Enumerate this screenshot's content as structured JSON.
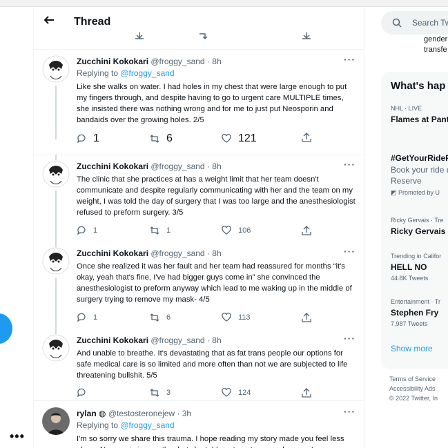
{
  "header": {
    "title": "Thread"
  },
  "left_nav": {
    "more_glyph": "•••"
  },
  "thread": {
    "tweets": [
      {
        "name": "Zucchini Kokokari",
        "handle": "@froggy_sand · 8h",
        "replying_prefix": "Replying to ",
        "replying_to": "@froggy_sand",
        "text": "Like she walks on water. I had holes in my chest that were large enough to put my fingers through, and despite having to go to urgent care MULTIPLE times, she insisted there was nothing wrong and for me to just put Neosporin and bandaids over the growing holes. 2/5",
        "replies": "1",
        "retweets": "6",
        "likes": "121"
      },
      {
        "name": "Zucchini Kokokari",
        "handle": "@froggy_sand · 8h",
        "text": "The clinic that she practices at has a weight limit that her team doesn't communicate and despite regularly communicating with her and the team on my weight, I was told the day of surgery that I was too large and the anesthesiologist refused to preform surgery. 3/5",
        "replies": "1",
        "retweets": "1",
        "likes": "106"
      },
      {
        "name": "Zucchini Kokokari",
        "handle": "@froggy_sand · 8h",
        "text": "Once she realized it was her fault and her team had reassured for months “it's okay, yeah that's fine, I've had bigger guys come in” she convinced the anesthesiologist to preform anyway which lead to me waking up in the middle of surgery trying to remove my mask- 4/5",
        "replies": "1",
        "retweets": "6",
        "likes": "113"
      },
      {
        "name": "Zucchini Kokokari",
        "handle": "@froggy_sand · 8h",
        "text": "And unable to breathe. It's devastating that as fat trans people our options for safe medical care is so limited and more often than not we are subjected to life threatening bullshit. 5/5",
        "replies": "",
        "retweets": "3",
        "likes": "124"
      },
      {
        "name": "rylan",
        "verified_glyph": "◍",
        "handle": "@testosteronejew · 3h",
        "replying_prefix": "Replying to ",
        "replying_to": "@froggy_sand",
        "text": "I'm so sorry we share this trauma. I hope reading my story made you feel less alone. Neosporin is exactly what she told me to put on my abscess. I"
      }
    ]
  },
  "sidebar": {
    "search_placeholder": "Search Tw",
    "snippet_line1": "gender",
    "snippet_line2": "transfe",
    "trends_title": "What's hap",
    "trends": [
      {
        "meta": "NHL · LIVE",
        "name": "Flames at Pant"
      },
      {
        "meta": "",
        "name": "#GetYourRideF",
        "desc1": "Book your ride u",
        "desc2": "Reserve",
        "promo": "Promoted by U"
      },
      {
        "meta": "Ricky Gervais · Tre",
        "name": "Ricky Gervais"
      },
      {
        "meta": "Trending in Califor",
        "name": "HELL NO",
        "count": "44.8K Tweets"
      },
      {
        "meta": "Entertainment · Tr",
        "name": "Stephen Fry",
        "count": "7,987 Tweets"
      }
    ],
    "show_more": "Show more",
    "footer": {
      "terms": "Terms of Service",
      "accessibility": "Accessibility",
      "ads": "Ads",
      "copyright": "© 2022 Twitter, In"
    }
  },
  "colors": {
    "accent": "#1d9bf0",
    "muted": "#536471",
    "thread_line": "#cfd9de"
  }
}
